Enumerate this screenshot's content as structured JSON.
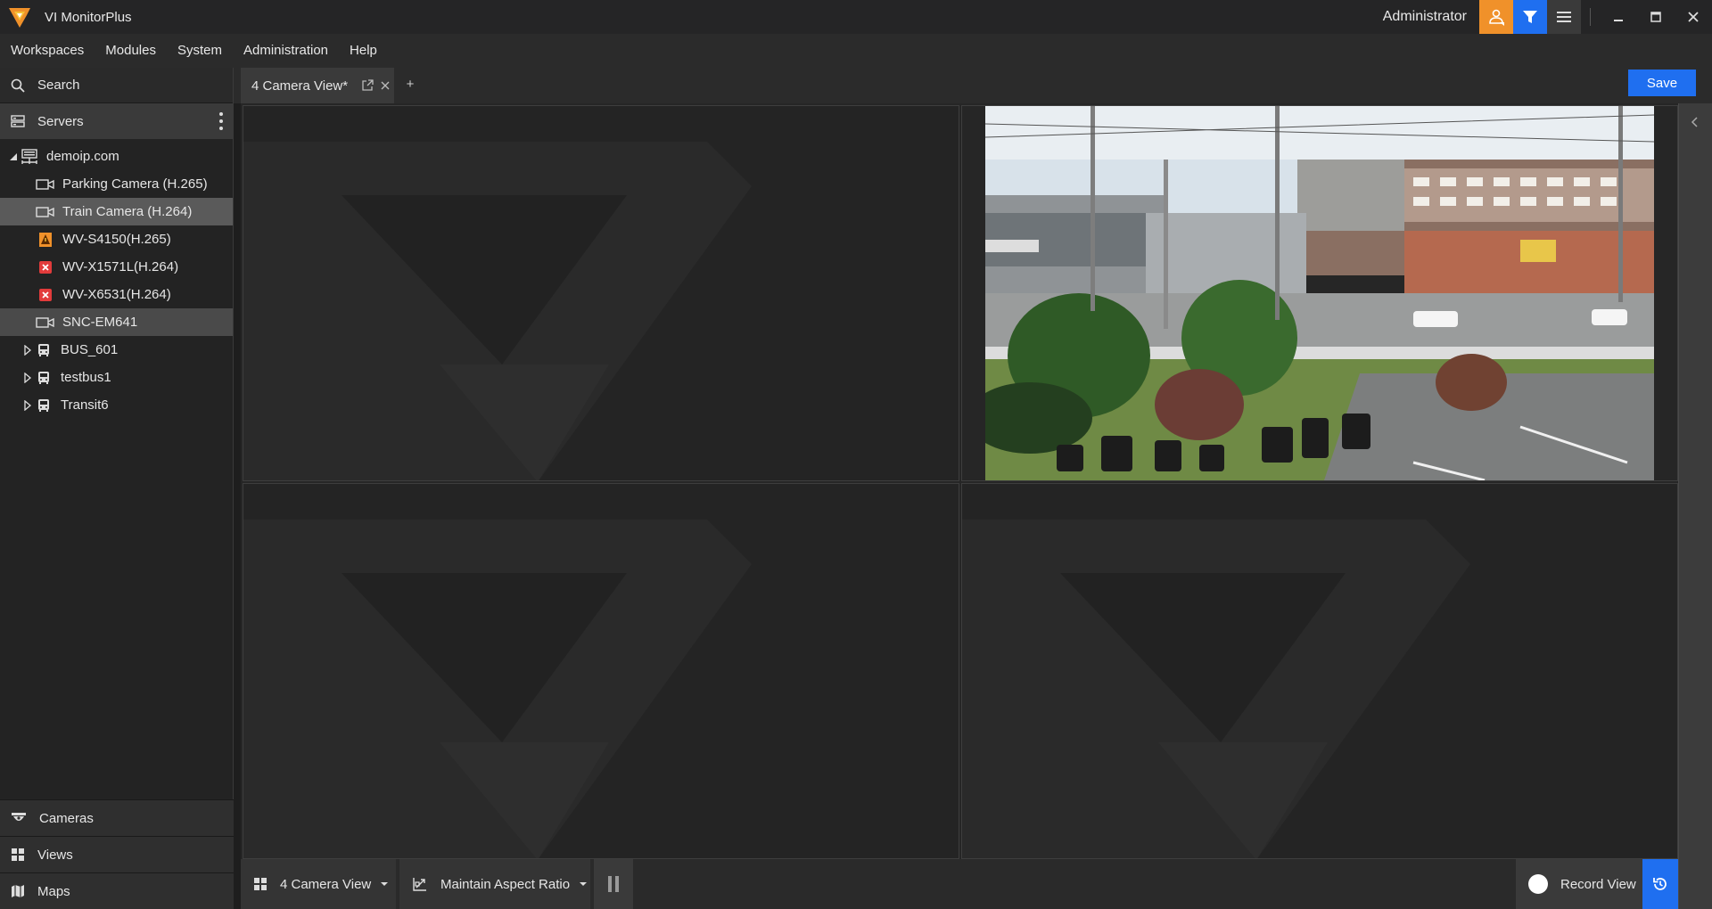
{
  "app": {
    "title": "VI MonitorPlus",
    "user": "Administrator"
  },
  "titlebar": {
    "icons": [
      "user-alert-icon",
      "filter-icon",
      "menu-icon",
      "minimize-icon",
      "maximize-icon",
      "close-icon"
    ]
  },
  "menu": [
    "Workspaces",
    "Modules",
    "System",
    "Administration",
    "Help"
  ],
  "sidebar": {
    "search_label": "Search",
    "servers_label": "Servers",
    "tree": [
      {
        "label": "demoip.com",
        "type": "server",
        "expanded": true
      },
      {
        "label": "Parking Camera (H.265)",
        "type": "camera",
        "status": "ok"
      },
      {
        "label": "Train Camera (H.264)",
        "type": "camera",
        "status": "ok",
        "selected": true
      },
      {
        "label": "WV-S4150(H.265)",
        "type": "camera",
        "status": "warning"
      },
      {
        "label": "WV-X1571L(H.264)",
        "type": "camera",
        "status": "error"
      },
      {
        "label": "WV-X6531(H.264)",
        "type": "camera",
        "status": "error"
      },
      {
        "label": "SNC-EM641",
        "type": "camera",
        "status": "ok",
        "selected": true
      },
      {
        "label": "BUS_601",
        "type": "bus",
        "expanded": false
      },
      {
        "label": "testbus1",
        "type": "bus",
        "expanded": false
      },
      {
        "label": "Transit6",
        "type": "bus",
        "expanded": false
      }
    ],
    "bottom": [
      "Cameras",
      "Views",
      "Maps"
    ]
  },
  "tabs": {
    "active_tab": "4 Camera View*",
    "add_label": "+",
    "save_label": "Save"
  },
  "toolbar": {
    "layout_label": "4 Camera View",
    "aspect_label": "Maintain Aspect Ratio",
    "record_label": "Record View"
  },
  "colors": {
    "accent_blue": "#1f6ff0",
    "accent_orange": "#f0912a",
    "error_red": "#e23b3b"
  }
}
